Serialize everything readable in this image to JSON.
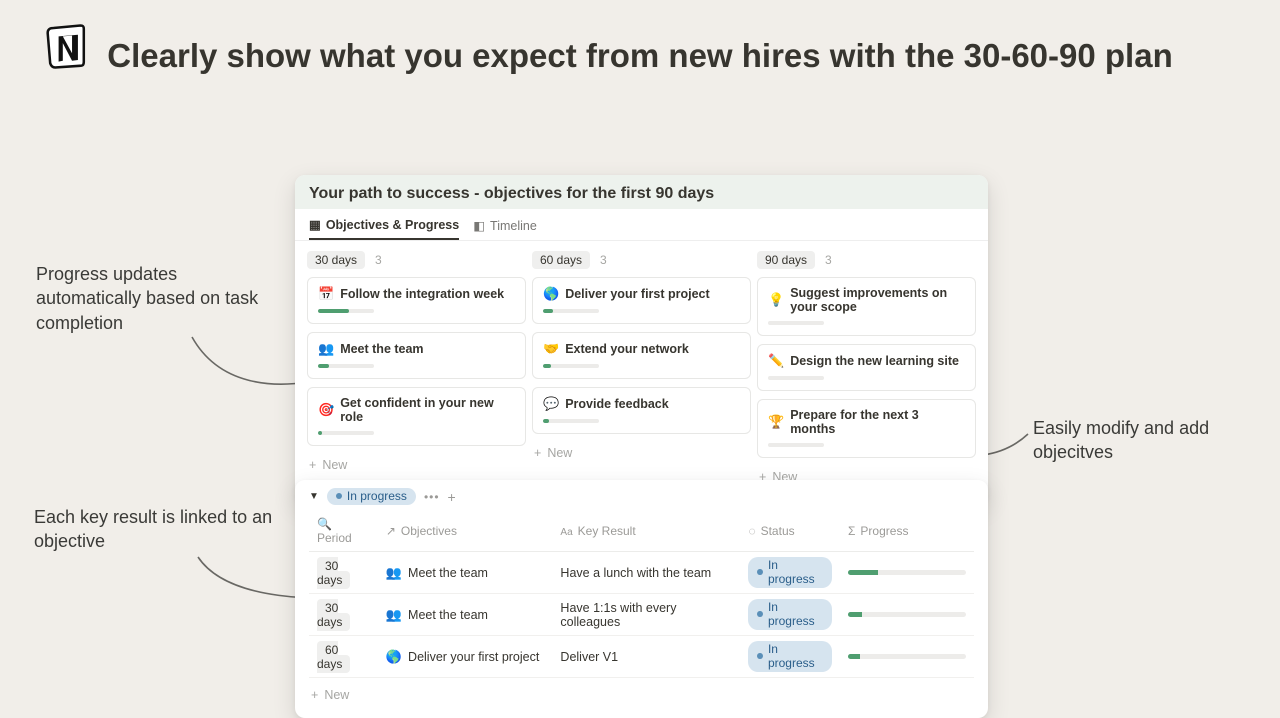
{
  "headline": "Clearly show what you expect from new hires with the 30-60-90 plan",
  "annotations": {
    "left1": "Progress updates automatically based on task completion",
    "left2": "Each key result is linked to an objective",
    "right": "Easily modify and add objecitves"
  },
  "panel1": {
    "title": "Your path to success - objectives for the first 90 days",
    "tabs": {
      "objectives": "Objectives & Progress",
      "timeline": "Timeline"
    },
    "new_label": "New",
    "columns": [
      {
        "label": "30 days",
        "count": "3",
        "cards": [
          {
            "emoji": "📅",
            "title": "Follow the integration week",
            "progress": 55
          },
          {
            "emoji": "👥",
            "title": "Meet the team",
            "progress": 20
          },
          {
            "emoji": "🎯",
            "title": "Get confident in your new role",
            "progress": 8
          }
        ]
      },
      {
        "label": "60 days",
        "count": "3",
        "cards": [
          {
            "emoji": "🌎",
            "title": "Deliver your first project",
            "progress": 18
          },
          {
            "emoji": "🤝",
            "title": "Extend your network",
            "progress": 14
          },
          {
            "emoji": "💬",
            "title": "Provide feedback",
            "progress": 10
          }
        ]
      },
      {
        "label": "90 days",
        "count": "3",
        "cards": [
          {
            "emoji": "💡",
            "title": "Suggest improvements on your scope",
            "progress": 0
          },
          {
            "emoji": "✏️",
            "title": "Design the new learning site",
            "progress": 0
          },
          {
            "emoji": "🏆",
            "title": "Prepare for the next 3 months",
            "progress": 0
          }
        ]
      }
    ]
  },
  "panel2": {
    "groupLabel": "In progress",
    "headers": {
      "period": "Period",
      "objectives": "Objectives",
      "keyresult": "Key Result",
      "status": "Status",
      "progress": "Progress"
    },
    "new_label": "New",
    "rows": [
      {
        "period": "30 days",
        "emoji": "👥",
        "objective": "Meet the team",
        "kr": "Have a lunch with the team",
        "status": "In progress",
        "progress": 25
      },
      {
        "period": "30 days",
        "emoji": "👥",
        "objective": "Meet the team",
        "kr": "Have 1:1s with every colleagues",
        "status": "In progress",
        "progress": 12
      },
      {
        "period": "60 days",
        "emoji": "🌎",
        "objective": "Deliver your first project",
        "kr": "Deliver V1",
        "status": "In progress",
        "progress": 10
      }
    ]
  }
}
